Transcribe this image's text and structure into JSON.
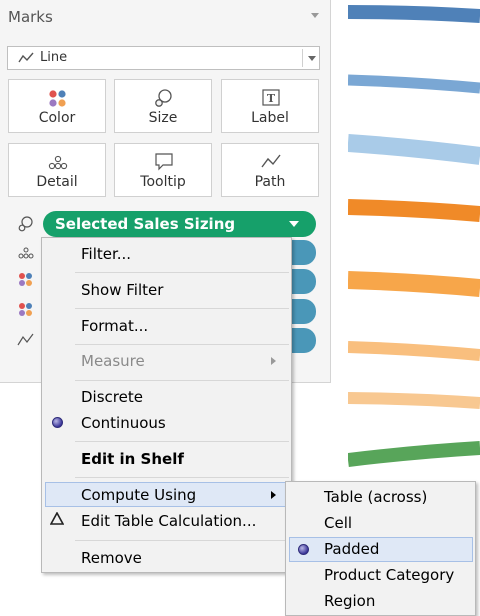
{
  "marks": {
    "title": "Marks",
    "mark_type": "Line",
    "cards": [
      {
        "label": "Color"
      },
      {
        "label": "Size"
      },
      {
        "label": "Label"
      },
      {
        "label": "Detail"
      },
      {
        "label": "Tooltip"
      },
      {
        "label": "Path"
      }
    ],
    "pill": {
      "label": "Selected Sales Sizing",
      "color": "#16a06a"
    },
    "secondary_pill_color": "#4a97b8"
  },
  "context_menu": {
    "items": [
      {
        "label": "Filter..."
      },
      {
        "label": "Show Filter"
      },
      {
        "label": "Format..."
      },
      {
        "label": "Measure",
        "disabled": true
      },
      {
        "label": "Discrete"
      },
      {
        "label": "Continuous",
        "checked": true
      },
      {
        "label": "Edit in Shelf"
      },
      {
        "label": "Compute Using",
        "highlighted": true
      },
      {
        "label": "Edit Table Calculation..."
      },
      {
        "label": "Remove"
      }
    ]
  },
  "submenu": {
    "items": [
      {
        "label": "Table (across)"
      },
      {
        "label": "Cell"
      },
      {
        "label": "Padded",
        "checked": true
      },
      {
        "label": "Product Category"
      },
      {
        "label": "Region"
      }
    ]
  },
  "chart_lines": [
    {
      "color": "#4f81b8"
    },
    {
      "color": "#7aa7d4"
    },
    {
      "color": "#a9cbe8"
    },
    {
      "color": "#f08a28"
    },
    {
      "color": "#f7a64a"
    },
    {
      "color": "#f9bf7e"
    },
    {
      "color": "#f8c891"
    },
    {
      "color": "#58a55a"
    }
  ]
}
